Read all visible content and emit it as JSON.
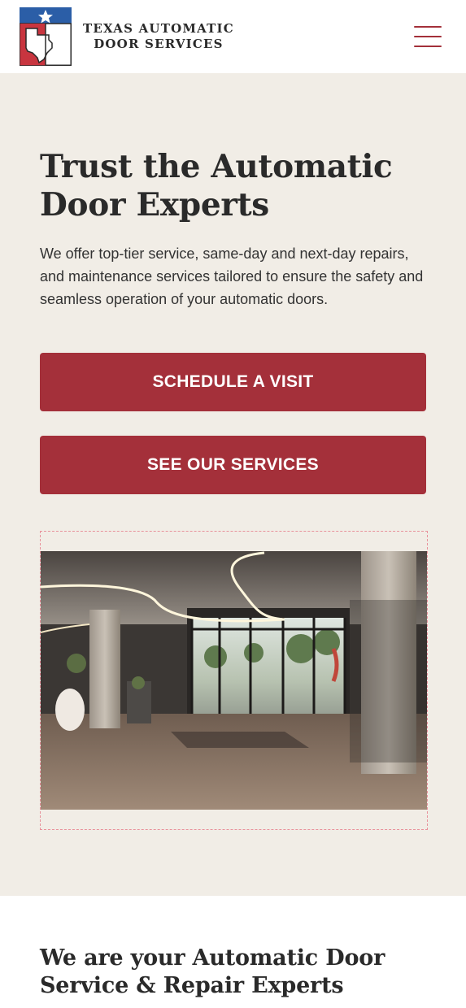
{
  "header": {
    "logo_line1": "TEXAS AUTOMATIC",
    "logo_line2": "DOOR SERVICES",
    "menu_icon": "hamburger-menu-icon"
  },
  "hero": {
    "title": "Trust the Automatic Door Experts",
    "description": "We offer top-tier service, same-day and next-day repairs, and maintenance services tailored to ensure the safety and seamless operation of your automatic doors.",
    "primary_button": "SCHEDULE A VISIT",
    "secondary_button": "SEE OUR SERVICES"
  },
  "section2": {
    "title": "We are your Automatic Door Service & Repair Experts"
  },
  "colors": {
    "accent": "#a4303a",
    "hero_bg": "#f1ede6",
    "flag_blue": "#2b5ea7",
    "text": "#2a2a2a"
  }
}
